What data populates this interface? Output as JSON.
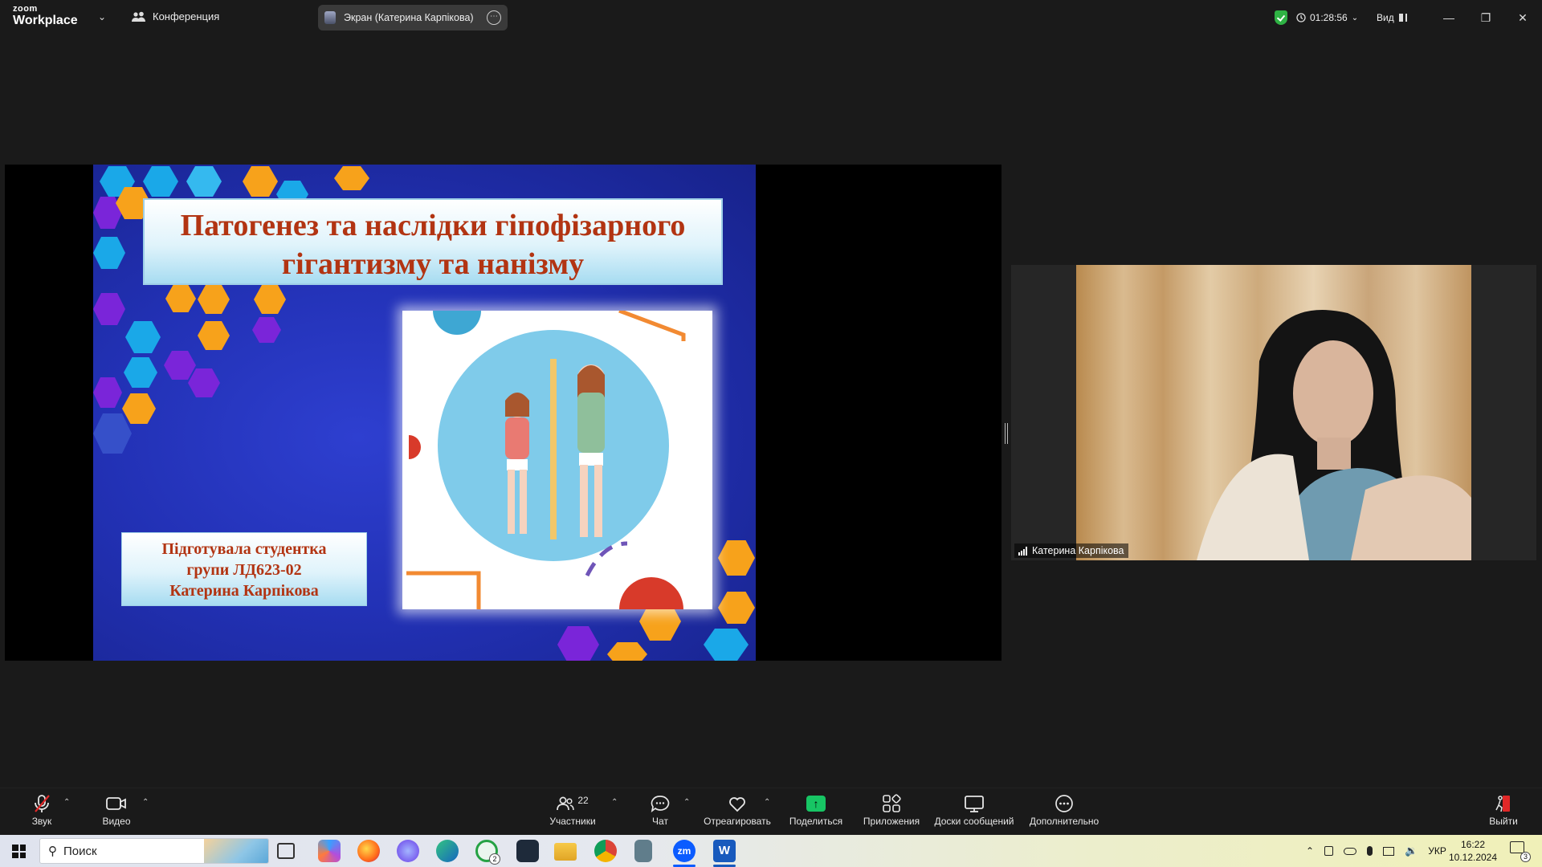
{
  "topbar": {
    "brand_small": "zoom",
    "brand": "Workplace",
    "conference_label": "Конференция",
    "screen_share_label": "Экран (Катерина Карпікова)",
    "timer": "01:28:56",
    "view_label": "Вид"
  },
  "slide": {
    "title_line1": "Патогенез та наслідки гіпофізарного",
    "title_line2": "гігантизму та нанізму",
    "author_line1": "Підготувала студентка",
    "author_line2": "групи ЛД623-02",
    "author_line3": "Катерина  Карпікова"
  },
  "video": {
    "participant_name": "Катерина Карпікова"
  },
  "toolbar": {
    "audio_label": "Звук",
    "video_label": "Видео",
    "participants_label": "Участники",
    "participants_count": "22",
    "chat_label": "Чат",
    "react_label": "Отреагировать",
    "share_label": "Поделиться",
    "apps_label": "Приложения",
    "whiteboards_label": "Доски сообщений",
    "more_label": "Дополнительно",
    "leave_label": "Выйти"
  },
  "taskbar": {
    "search_placeholder": "Поиск",
    "whatsapp_badge": "2",
    "zoom_app_label": "zm",
    "word_app_label": "W",
    "language": "УКР",
    "time": "16:22",
    "date": "10.12.2024",
    "notifications_count": "3"
  },
  "colors": {
    "zoom_accent": "#0b5cff",
    "share_green": "#17c564",
    "leave_red": "#e02828",
    "slide_title_red": "#b23412"
  }
}
